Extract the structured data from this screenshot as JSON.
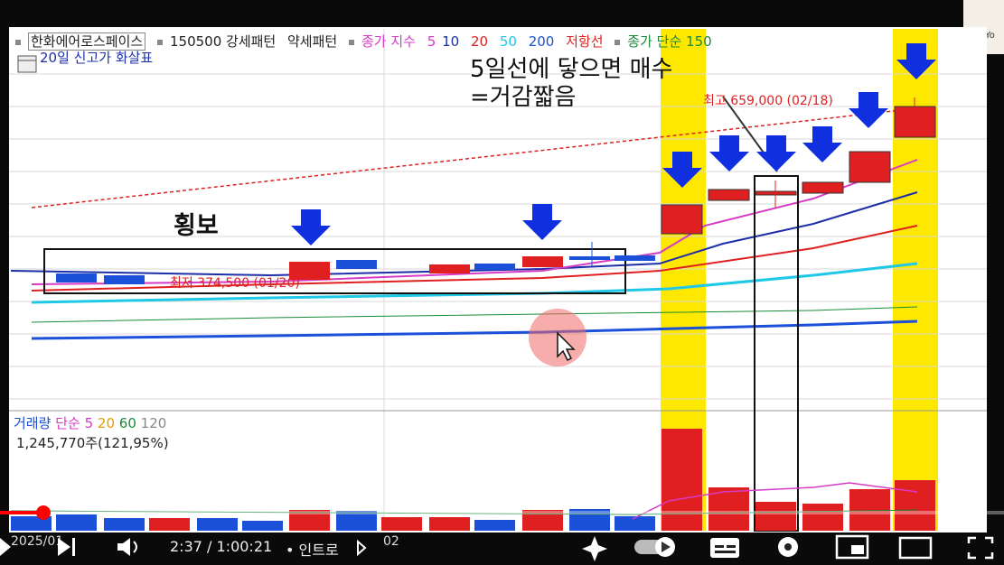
{
  "legend": {
    "stock_name": "한화에어로스페이스",
    "code_text": "150500 강세패턴",
    "weak_text": "약세패턴",
    "ma_label": "종가 지수",
    "ma_values": [
      "5",
      "10",
      "20",
      "50",
      "200"
    ],
    "ma_colors": [
      "#d63bc6",
      "#1c2fa8",
      "#e02020",
      "#1ec8e6",
      "#1b50d8"
    ],
    "resistance": "저항선",
    "simple_label": "종가 단순 150",
    "new_high_arrow": "20일 신고가 화살표"
  },
  "annotations": {
    "title_line1": "5일선에 닿으면 매수",
    "title_line2": "=거감짧음",
    "sideways": "횡보",
    "high_label": "최고 659,000 (02/18)",
    "low_label": "최저 374,500 (01/20)"
  },
  "volume": {
    "legend_label": "거래량",
    "ma_label": "단순",
    "ma_values": [
      "5",
      "20",
      "60",
      "120"
    ],
    "ma_colors": [
      "#d63bc6",
      "#e0a000",
      "#1a8a3a",
      "#888888"
    ],
    "count": "1,245,770주(121,95%)"
  },
  "axis": {
    "date_left": "2025/01",
    "date_mid": "02"
  },
  "player": {
    "time": "2:37 / 1:00:21",
    "chapter": "• 인트로",
    "progress_fraction": 0.0435,
    "icons": [
      "play-icon",
      "next-icon",
      "volume-icon",
      "sparkle-icon",
      "autoplay-toggle",
      "captions-icon",
      "settings-gear-icon",
      "miniplayer-icon",
      "theater-icon",
      "fullscreen-icon"
    ]
  },
  "channel_thumb_text": "Yo"
}
